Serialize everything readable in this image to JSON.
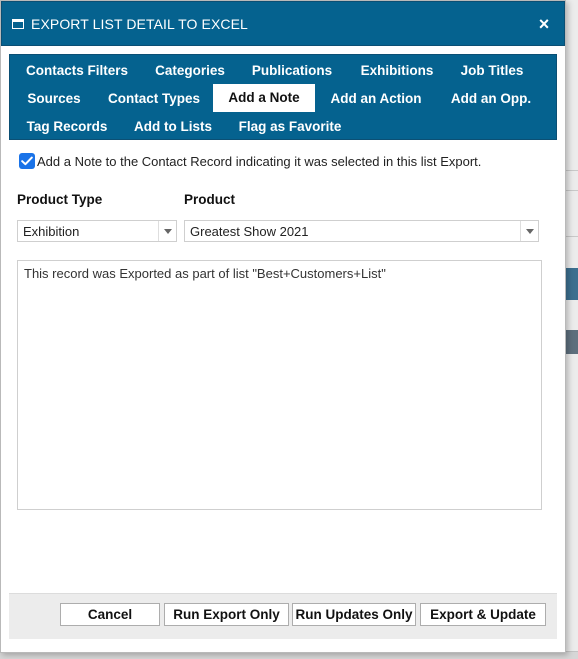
{
  "dialog": {
    "title": "EXPORT LIST DETAIL TO EXCEL",
    "close_label": "×"
  },
  "tabs": [
    {
      "label": "Contacts Filters",
      "active": false
    },
    {
      "label": "Categories",
      "active": false
    },
    {
      "label": "Publications",
      "active": false
    },
    {
      "label": "Exhibitions",
      "active": false
    },
    {
      "label": "Job Titles",
      "active": false
    },
    {
      "label": "Sources",
      "active": false
    },
    {
      "label": "Contact Types",
      "active": false
    },
    {
      "label": "Add a Note",
      "active": true
    },
    {
      "label": "Add an Action",
      "active": false
    },
    {
      "label": "Add an Opp.",
      "active": false
    },
    {
      "label": "Tag Records",
      "active": false
    },
    {
      "label": "Add to Lists",
      "active": false
    },
    {
      "label": "Flag as Favorite",
      "active": false
    }
  ],
  "note_option": {
    "checked": true,
    "label": "Add a Note to the Contact Record indicating it was selected in this list Export."
  },
  "fields": {
    "product_type_label": "Product Type",
    "product_type_value": "Exhibition",
    "product_label": "Product",
    "product_value": "Greatest Show 2021"
  },
  "note_text": "This record was Exported as part of list \"Best+Customers+List\"",
  "buttons": {
    "cancel": "Cancel",
    "run_export_only": "Run Export Only",
    "run_updates_only": "Run Updates Only",
    "export_update": "Export & Update"
  },
  "colors": {
    "header_blue": "#05628f",
    "checkbox_blue": "#1a73e8"
  }
}
